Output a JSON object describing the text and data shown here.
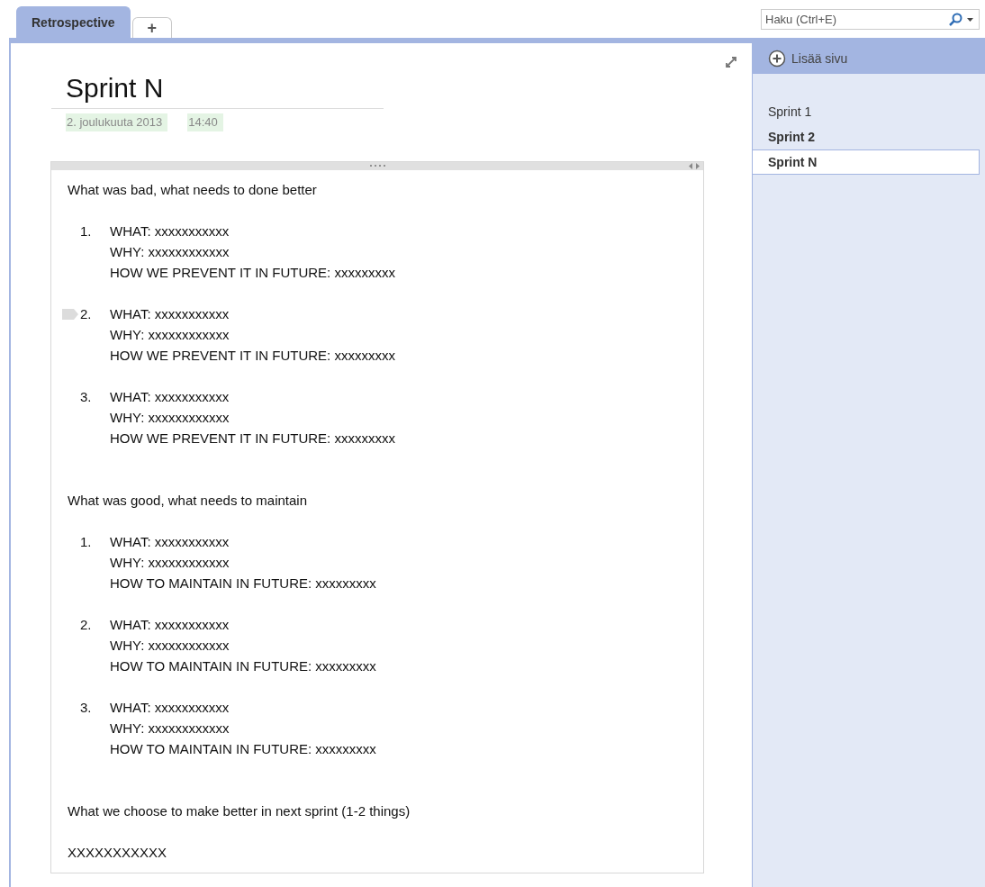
{
  "notebook_tabs": [
    {
      "label": "Retrospective",
      "selected": true
    },
    {
      "label": "+",
      "selected": false
    }
  ],
  "search": {
    "placeholder": "Haku (Ctrl+E)"
  },
  "page": {
    "title": "Sprint N",
    "date": "2. joulukuuta 2013",
    "time": "14:40",
    "sections": [
      {
        "heading": "What was bad, what needs to done better",
        "items": [
          {
            "number": "1.",
            "tagged": false,
            "lines": [
              {
                "label": "WHAT:",
                "value": "xxxxxxxxxxx"
              },
              {
                "label": "WHY:",
                "value": "xxxxxxxxxxxx"
              },
              {
                "label": "HOW WE PREVENT IT IN FUTURE:",
                "value": "xxxxxxxxx"
              }
            ]
          },
          {
            "number": "2.",
            "tagged": true,
            "lines": [
              {
                "label": "WHAT:",
                "value": "xxxxxxxxxxx"
              },
              {
                "label": "WHY:",
                "value": "xxxxxxxxxxxx"
              },
              {
                "label": "HOW WE PREVENT IT IN FUTURE:",
                "value": "xxxxxxxxx"
              }
            ]
          },
          {
            "number": "3.",
            "tagged": false,
            "lines": [
              {
                "label": "WHAT:",
                "value": "xxxxxxxxxxx"
              },
              {
                "label": "WHY:",
                "value": "xxxxxxxxxxxx"
              },
              {
                "label": "HOW WE PREVENT IT IN FUTURE:",
                "value": "xxxxxxxxx"
              }
            ]
          }
        ]
      },
      {
        "heading": "What was good, what needs to maintain",
        "items": [
          {
            "number": "1.",
            "tagged": false,
            "lines": [
              {
                "label": "WHAT:",
                "value": "xxxxxxxxxxx"
              },
              {
                "label": "WHY:",
                "value": "xxxxxxxxxxxx"
              },
              {
                "label": "HOW TO MAINTAIN IN FUTURE:",
                "value": "xxxxxxxxx"
              }
            ]
          },
          {
            "number": "2.",
            "tagged": false,
            "lines": [
              {
                "label": "WHAT:",
                "value": "xxxxxxxxxxx"
              },
              {
                "label": "WHY:",
                "value": "xxxxxxxxxxxx"
              },
              {
                "label": "HOW TO MAINTAIN IN FUTURE:",
                "value": "xxxxxxxxx"
              }
            ]
          },
          {
            "number": "3.",
            "tagged": false,
            "lines": [
              {
                "label": "WHAT:",
                "value": "xxxxxxxxxxx"
              },
              {
                "label": "WHY:",
                "value": "xxxxxxxxxxxx"
              },
              {
                "label": "HOW TO MAINTAIN IN FUTURE:",
                "value": "xxxxxxxxx"
              }
            ]
          }
        ]
      },
      {
        "heading": "What we choose to make better in next sprint (1-2 things)",
        "text": "XXXXXXXXXXX"
      }
    ]
  },
  "sidebar": {
    "add_page": "Lisää sivu",
    "pages": [
      {
        "label": "Sprint 1",
        "bold": false,
        "selected": false
      },
      {
        "label": "Sprint 2",
        "bold": true,
        "selected": false
      },
      {
        "label": "Sprint N",
        "bold": true,
        "selected": true
      }
    ]
  }
}
